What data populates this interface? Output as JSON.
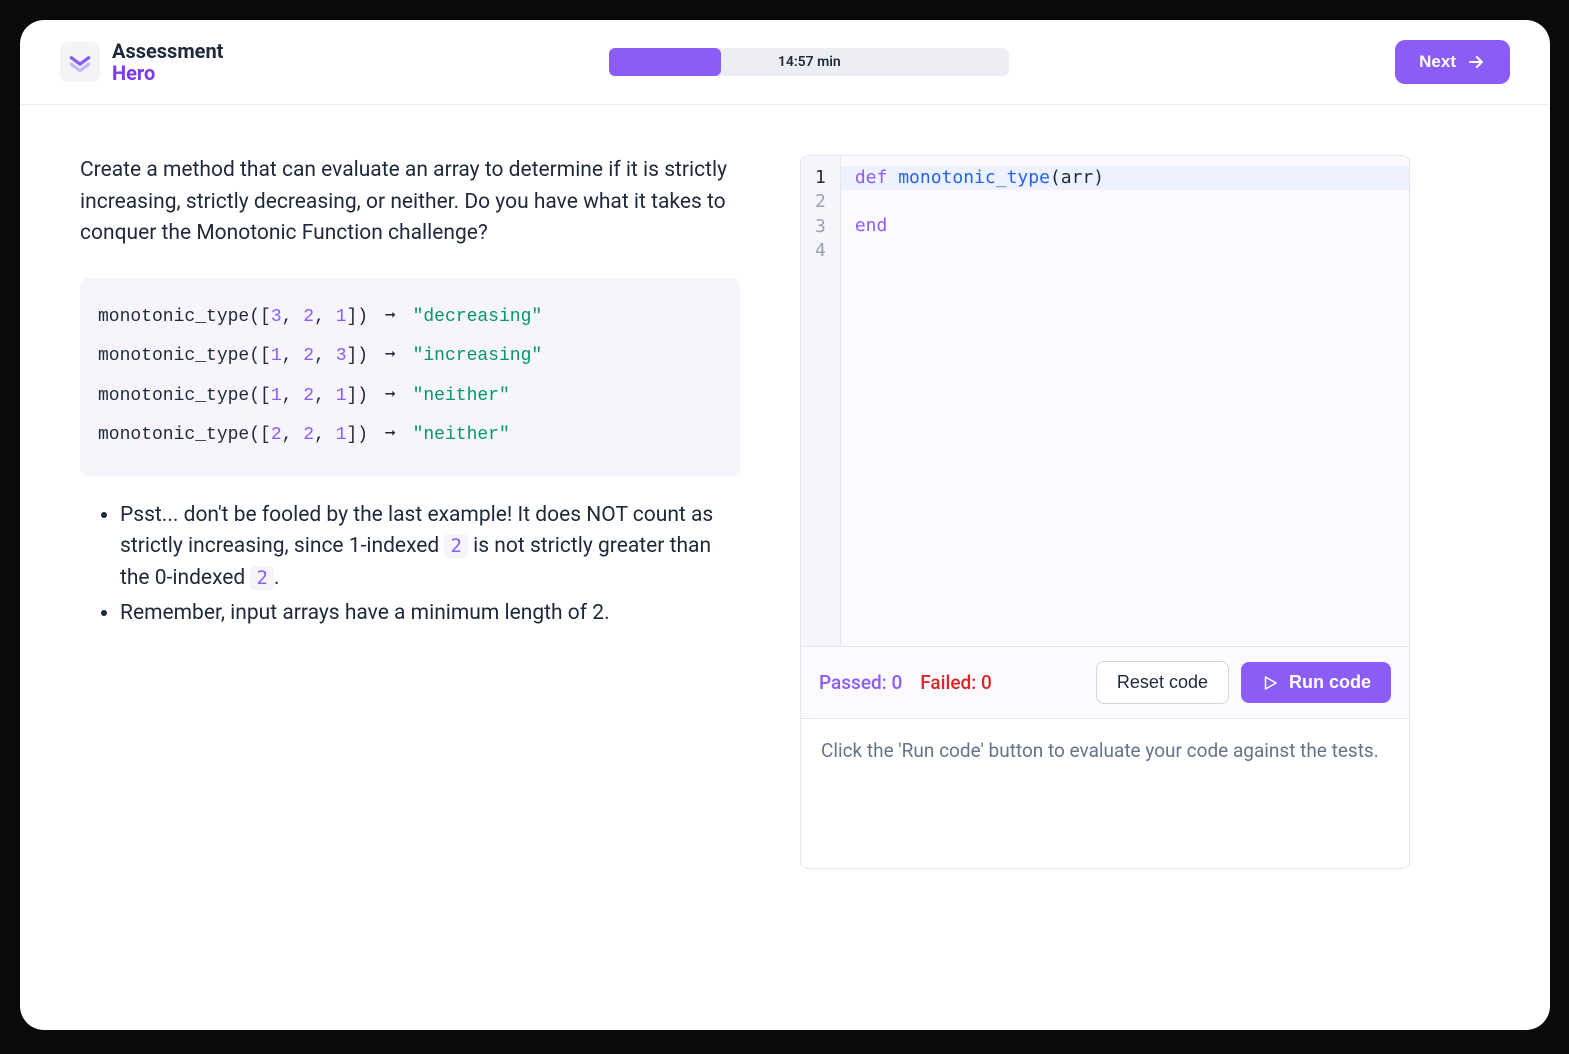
{
  "brand": {
    "line1": "Assessment",
    "line2": "Hero"
  },
  "timer": {
    "text": "14:57 min",
    "progress_percent": 28
  },
  "next_button": "Next",
  "problem": {
    "description": "Create a method that can evaluate an array to determine if it is strictly increasing, strictly decreasing, or neither. Do you have what it takes to conquer the Monotonic Function challenge?",
    "examples": [
      {
        "fn": "monotonic_type",
        "args": [
          "3",
          "2",
          "1"
        ],
        "result": "\"decreasing\""
      },
      {
        "fn": "monotonic_type",
        "args": [
          "1",
          "2",
          "3"
        ],
        "result": "\"increasing\""
      },
      {
        "fn": "monotonic_type",
        "args": [
          "1",
          "2",
          "1"
        ],
        "result": "\"neither\""
      },
      {
        "fn": "monotonic_type",
        "args": [
          "2",
          "2",
          "1"
        ],
        "result": "\"neither\""
      }
    ],
    "notes": {
      "n1_p1": "Psst... don't be fooled by the last example! It does NOT count as strictly increasing, since 1-indexed ",
      "n1_c1": "2",
      "n1_p2": " is not strictly greater than the 0-indexed ",
      "n1_c2": "2",
      "n1_p3": ".",
      "n2": "Remember, input arrays have a minimum length of 2."
    }
  },
  "editor": {
    "lines": [
      "1",
      "2",
      "3",
      "4"
    ],
    "code": {
      "l1_kw": "def",
      "l1_fn": "monotonic_type",
      "l1_args": "(arr)",
      "l3_kw": "end"
    }
  },
  "controls": {
    "passed_label": "Passed: 0",
    "failed_label": "Failed: 0",
    "reset": "Reset code",
    "run": "Run code"
  },
  "output_hint": "Click the 'Run code' button to evaluate your code against the tests."
}
